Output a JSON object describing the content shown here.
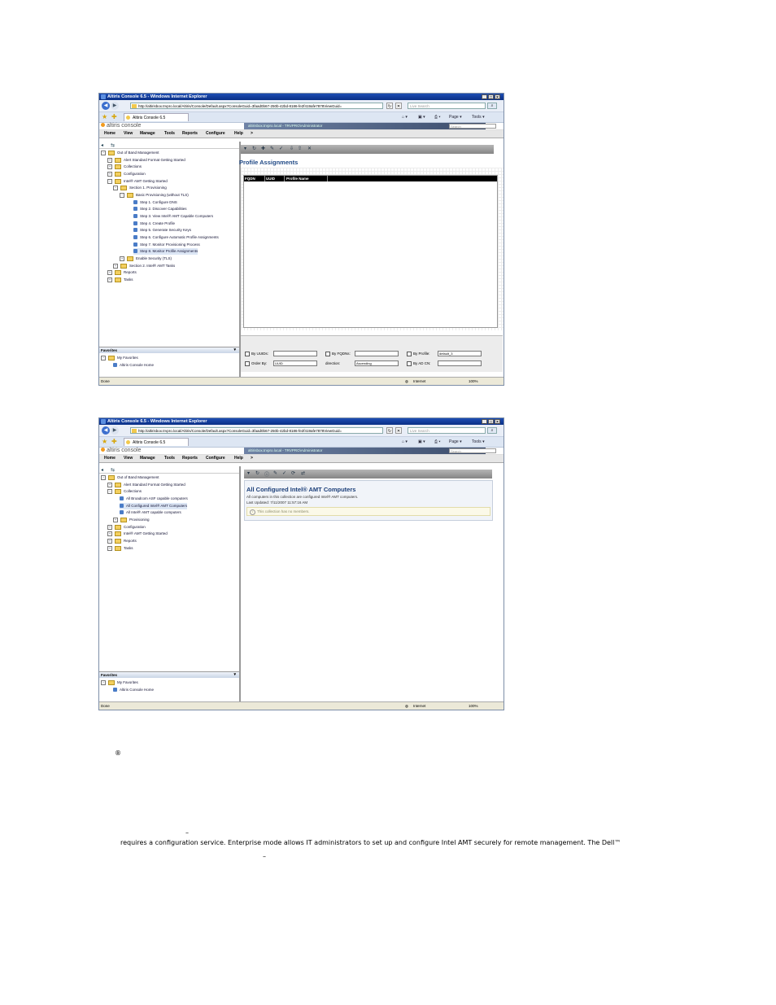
{
  "browser": {
    "window_title": "Altiris Console 6.5 - Windows Internet Explorer",
    "url": "http://altirisbox.trvpro.local/Altiris/Console/Default.aspx?ConsoleGuid=3faad0b67-250b-42bd-8186-fe2f419afe7878ViewGuid=",
    "search_placeholder": "Live Search",
    "tab_label": "Altiris Console 6.5",
    "cmd_page": "Page",
    "cmd_tools": "Tools",
    "status_done": "Done",
    "status_zone": "Internet",
    "status_zoom": "100%"
  },
  "console": {
    "logo": "altiris console",
    "user": "altirisbox.trvpro.local - TRVPRO\\Administrator",
    "search_placeholder": "Search",
    "menu": [
      "Home",
      "View",
      "Manage",
      "Tools",
      "Reports",
      "Configure",
      "Help",
      ">"
    ],
    "favorites_header": "Favorites",
    "fav_my": "My Favorites",
    "fav_home": "Altiris Console Home"
  },
  "screen1": {
    "tree": [
      "Out of Band Management",
      "Alert Standard Format Getting Started",
      "Collections",
      "Configuration",
      "Intel® AMT Getting Started",
      "Section 1. Provisioning",
      "Basic Provisioning (without TLS)",
      "Step 1. Configure DNS",
      "Step 2. Discover Capabilities",
      "Step 3. View Intel® AMT Capable Computers",
      "Step 4. Create Profile",
      "Step 5. Generate Security Keys",
      "Step 6. Configure Automatic Profile Assignments",
      "Step 7. Monitor Provisioning Process",
      "Step 8. Monitor Profile Assignments",
      "Enable Security (TLS)",
      "Section 2. Intel® AMT Tasks",
      "Reports",
      "Tasks"
    ],
    "page_title": "Profile Assignments",
    "columns": [
      "FQDN",
      "UUID",
      "Profile Name"
    ],
    "filters": {
      "by_uuid": "By UUIDs:",
      "by_fqdn": "By FQDNs:",
      "by_profile": "By Profile:",
      "profile_value": "default_3",
      "order_by": "Order By:",
      "order_value": "UUID",
      "direction": "direction:",
      "direction_value": "Ascending",
      "by_ad": "By AD CN:"
    }
  },
  "screen2": {
    "tree": [
      "Out of Band Management",
      "Alert Standard Format Getting Started",
      "Collections",
      "All Broadcom ASF capable computers",
      "All Configured Intel® AMT Computers",
      "All Intel® AMT capable computers",
      "Provisioning",
      "Configuration",
      "Intel® AMT Getting Started",
      "Reports",
      "Tasks"
    ],
    "title": "All Configured Intel® AMT Computers",
    "desc": "All computers in this collection are configured Intel® AMT computers.",
    "last_updated": "Last Updated:    7/11/2007 11:57:16 AM",
    "no_members": "This collection has no members."
  },
  "document": {
    "reg_mark": "®",
    "dash1": "–",
    "line1": "requires a configuration service. Enterprise mode allows IT administrators to set up and configure Intel AMT securely for remote management. The Dell™",
    "dash2": "–"
  }
}
